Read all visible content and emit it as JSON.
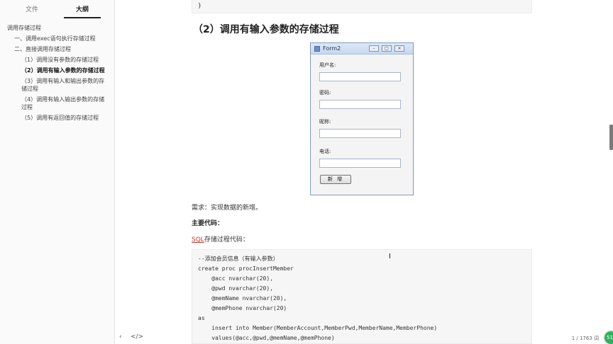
{
  "sidebar": {
    "tabs": [
      {
        "label": "文件"
      },
      {
        "label": "大纲"
      }
    ],
    "outline": [
      {
        "label": "调用存储过程"
      },
      {
        "label": "一、调用exec语句执行存储过程"
      },
      {
        "label": "二、直接调用存储过程"
      },
      {
        "label": "（1）调用没有参数的存储过程"
      },
      {
        "label": "（2）调用有输入参数的存储过程"
      },
      {
        "label": "（3）调用有输入和输出参数的存储过程"
      },
      {
        "label": "（4）调用有输入输出参数的存储过程"
      },
      {
        "label": "（5）调用有返回值的存储过程"
      }
    ],
    "footer": {
      "collapse_icon": "‹",
      "source_icon": "</>"
    }
  },
  "main": {
    "code_top": "}",
    "heading": "（2）调用有输入参数的存储过程",
    "form_window": {
      "title": "Form2",
      "fields": [
        {
          "label": "用户名:",
          "value": ""
        },
        {
          "label": "密码:",
          "value": ""
        },
        {
          "label": "昵称:",
          "value": ""
        },
        {
          "label": "电话:",
          "value": ""
        }
      ],
      "button": "新 增"
    },
    "requirement": "需求：实现数据的新增。",
    "main_code_label": "主要代码：",
    "sql_link": "SQL",
    "sql_caption": "存储过程代码：",
    "code_lines": [
      "--添加会员信息（有输入参数）",
      "create proc procInsertMember",
      "    @acc nvarchar(20),",
      "    @pwd nvarchar(20),",
      "    @memName nvarchar(20),",
      "    @memPhone nvarchar(20)",
      "as",
      "    insert into Member(MemberAccount,MemberPwd,MemberName,MemberPhone)",
      "    values(@acc,@pwd,@memName,@memPhone)"
    ]
  },
  "status": {
    "page_counter": "1 / 1763 词",
    "float_ball": "51"
  }
}
